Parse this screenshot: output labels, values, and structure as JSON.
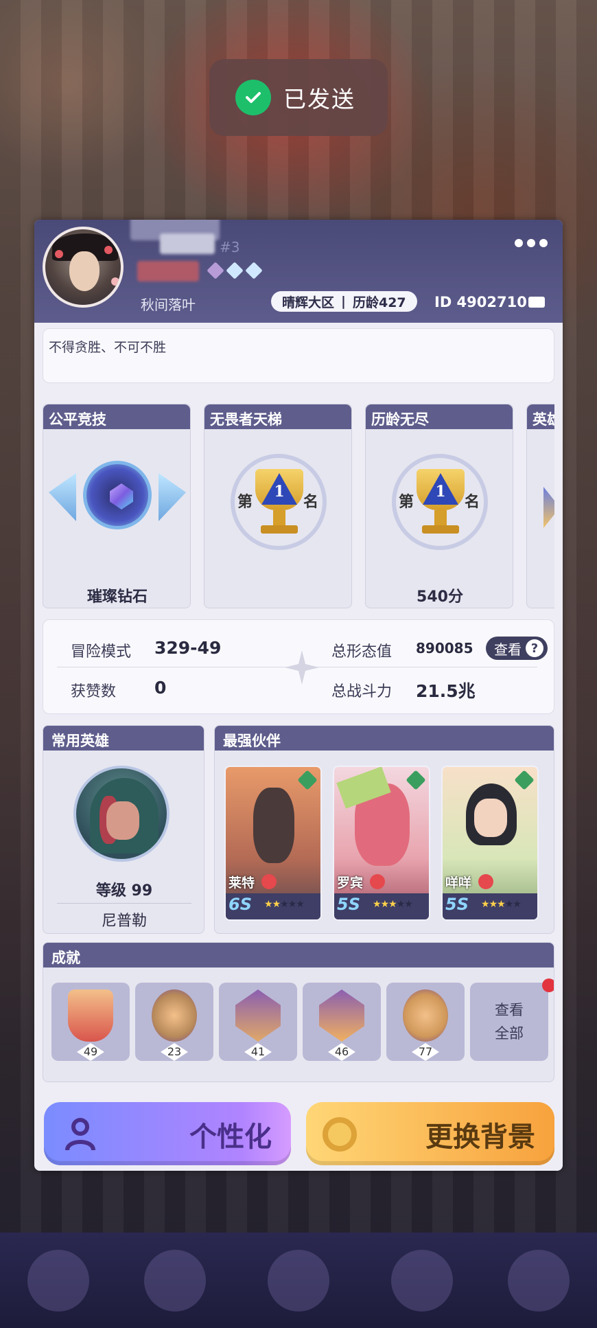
{
  "toast": {
    "text": "已发送"
  },
  "profile": {
    "name_suffix": "#3",
    "nickname": "秋间落叶",
    "server": "晴辉大区",
    "server_separator": "|",
    "history_age": "历龄427",
    "id": "ID 4902710",
    "signature": "不得贪胜、不可不胜"
  },
  "ranks": [
    {
      "title": "公平竞技",
      "label": "璀璨钻石",
      "emblem": "diamond-rank-icon"
    },
    {
      "title": "无畏者天梯",
      "label": "",
      "emblem": "trophy-first-place-icon",
      "left_char": "第",
      "num": "1",
      "right_char": "名"
    },
    {
      "title": "历龄无尽",
      "label": "540分",
      "emblem": "trophy-first-place-icon",
      "left_char": "第",
      "num": "1",
      "right_char": "名"
    },
    {
      "title": "英雄",
      "label": "",
      "emblem": "partial-emblem-icon"
    }
  ],
  "stats": {
    "adventure_label": "冒险模式",
    "adventure_value": "329-49",
    "likes_label": "获赞数",
    "likes_value": "0",
    "form_label": "总形态值",
    "form_value": "890085",
    "power_label": "总战斗力",
    "power_value": "21.5兆",
    "view_label": "查看",
    "view_q": "?"
  },
  "common_hero": {
    "title": "常用英雄",
    "level": "等级 99",
    "name": "尼普勒"
  },
  "partners": {
    "title": "最强伙伴",
    "items": [
      {
        "name": "莱特",
        "level": "6S",
        "stars": "★★★★★",
        "star_fill": 2
      },
      {
        "name": "罗宾",
        "level": "5S",
        "stars": "★★★★★",
        "star_fill": 3
      },
      {
        "name": "咩咩",
        "level": "5S",
        "stars": "★★★★★",
        "star_fill": 3
      }
    ]
  },
  "achievements": {
    "title": "成就",
    "items": [
      "49",
      "23",
      "41",
      "46",
      "77"
    ],
    "view_all_1": "查看",
    "view_all_2": "全部"
  },
  "buttons": {
    "personalize": "个性化",
    "change_bg": "更换背景"
  },
  "colors": {
    "header": "#5e5d8c",
    "toast_check": "#1dbf6b",
    "personalize_btn": "#b084ff",
    "change_bg_btn": "#f7a23d"
  }
}
